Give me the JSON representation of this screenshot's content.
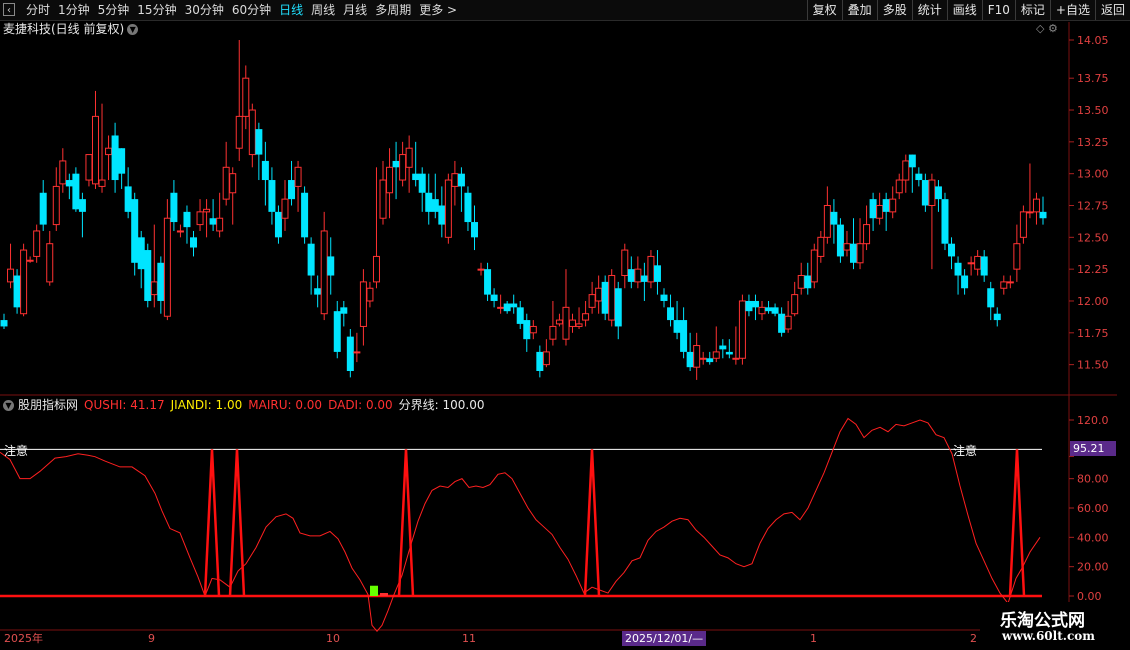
{
  "toolbar": {
    "back_glyph": "‹",
    "periods": [
      "分时",
      "1分钟",
      "5分钟",
      "15分钟",
      "30分钟",
      "60分钟",
      "日线",
      "周线",
      "月线",
      "多周期",
      "更多 >"
    ],
    "selected_period": "日线",
    "right_buttons": [
      "复权",
      "叠加",
      "多股",
      "统计",
      "画线",
      "F10",
      "标记",
      "+自选",
      "返回"
    ]
  },
  "stock": {
    "title": "麦捷科技(日线 前复权)"
  },
  "price_axis": {
    "ticks": [
      "14.05",
      "13.75",
      "13.50",
      "13.25",
      "13.00",
      "12.75",
      "12.50",
      "12.25",
      "12.00",
      "11.75",
      "11.50"
    ]
  },
  "indicator": {
    "name": "股朋指标网",
    "items": [
      {
        "label": "QUSHI: 41.17",
        "color": "#ff3030"
      },
      {
        "label": "JIANDI: 1.00",
        "color": "#ffee00"
      },
      {
        "label": "MAIRU: 0.00",
        "color": "#ff3030"
      },
      {
        "label": "DADI: 0.00",
        "color": "#ff3030"
      },
      {
        "label": "分界线: 100.00",
        "color": "#e8e8e8"
      }
    ],
    "axis_ticks": [
      "120.0",
      "95.21",
      "80.00",
      "60.00",
      "40.00",
      "20.00",
      "0.00"
    ],
    "current_level": "95.21",
    "warning_labels": [
      "注意",
      "注意"
    ]
  },
  "dates": {
    "labels": [
      "2025年",
      "9",
      "10",
      "11",
      "1",
      "2"
    ],
    "highlight": "2025/12/01/—"
  },
  "watermark": {
    "line1": "乐淘公式网",
    "line2": "www.60lt.com"
  },
  "colors": {
    "up": "#ff3232",
    "down": "#00e5ff",
    "qushi": "#ff2020",
    "signal": "#ff1010",
    "jiandi": "#66ff00"
  },
  "chart_data": {
    "type": "candlestick",
    "ylim": [
      11.2,
      14.2
    ],
    "candles": [
      [
        11.85,
        11.8,
        11.9,
        11.78
      ],
      [
        12.15,
        12.25,
        12.45,
        12.1
      ],
      [
        12.2,
        11.95,
        12.25,
        11.9
      ],
      [
        11.9,
        12.4,
        12.45,
        11.88
      ],
      [
        12.32,
        12.32,
        12.35,
        12.3
      ],
      [
        12.35,
        12.55,
        12.6,
        12.3
      ],
      [
        12.85,
        12.6,
        12.95,
        12.55
      ],
      [
        12.15,
        12.45,
        12.55,
        12.12
      ],
      [
        12.6,
        12.9,
        13.05,
        12.55
      ],
      [
        12.92,
        13.1,
        13.2,
        12.85
      ],
      [
        12.95,
        12.9,
        13.0,
        12.8
      ],
      [
        13.0,
        12.72,
        13.05,
        12.7
      ],
      [
        12.8,
        12.7,
        12.85,
        12.5
      ],
      [
        12.95,
        13.15,
        13.15,
        12.9
      ],
      [
        12.92,
        13.45,
        13.65,
        12.88
      ],
      [
        12.9,
        12.95,
        13.55,
        12.85
      ],
      [
        13.15,
        13.2,
        13.3,
        12.95
      ],
      [
        13.3,
        12.95,
        13.4,
        12.85
      ],
      [
        13.2,
        13.0,
        13.2,
        12.88
      ],
      [
        12.9,
        12.7,
        13.05,
        12.65
      ],
      [
        12.8,
        12.3,
        12.85,
        12.2
      ],
      [
        12.5,
        12.25,
        12.55,
        12.1
      ],
      [
        12.4,
        12.0,
        12.45,
        11.95
      ],
      [
        12.05,
        12.15,
        12.6,
        11.95
      ],
      [
        12.3,
        12.0,
        12.35,
        11.9
      ],
      [
        11.88,
        12.65,
        12.8,
        11.85
      ],
      [
        12.85,
        12.62,
        12.95,
        12.55
      ],
      [
        12.55,
        12.55,
        12.6,
        12.5
      ],
      [
        12.7,
        12.58,
        12.75,
        12.45
      ],
      [
        12.5,
        12.42,
        12.55,
        12.35
      ],
      [
        12.6,
        12.7,
        12.8,
        12.55
      ],
      [
        12.7,
        12.72,
        12.8,
        12.5
      ],
      [
        12.65,
        12.6,
        12.8,
        12.55
      ],
      [
        12.55,
        12.65,
        12.85,
        12.5
      ],
      [
        12.8,
        13.05,
        13.25,
        12.75
      ],
      [
        12.85,
        13.0,
        13.05,
        12.6
      ],
      [
        13.2,
        13.45,
        14.05,
        13.1
      ],
      [
        13.45,
        13.75,
        13.85,
        13.35
      ],
      [
        13.15,
        13.5,
        13.55,
        13.05
      ],
      [
        13.35,
        13.15,
        13.4,
        12.95
      ],
      [
        13.1,
        12.95,
        13.25,
        12.75
      ],
      [
        12.95,
        12.7,
        13.05,
        12.6
      ],
      [
        12.7,
        12.5,
        12.75,
        12.45
      ],
      [
        12.65,
        12.8,
        12.95,
        12.55
      ],
      [
        12.95,
        12.8,
        13.1,
        12.75
      ],
      [
        12.9,
        13.05,
        13.1,
        12.7
      ],
      [
        12.85,
        12.5,
        12.9,
        12.45
      ],
      [
        12.45,
        12.2,
        12.5,
        12.05
      ],
      [
        12.1,
        12.05,
        12.2,
        11.95
      ],
      [
        11.9,
        12.55,
        12.7,
        11.85
      ],
      [
        12.35,
        12.2,
        12.5,
        12.05
      ],
      [
        11.92,
        11.6,
        12.0,
        11.55
      ],
      [
        11.95,
        11.9,
        12.0,
        11.8
      ],
      [
        11.72,
        11.45,
        11.78,
        11.4
      ],
      [
        11.6,
        11.6,
        11.75,
        11.52
      ],
      [
        11.8,
        12.15,
        12.25,
        11.65
      ],
      [
        12.0,
        12.1,
        12.15,
        11.95
      ],
      [
        12.15,
        12.35,
        13.05,
        12.1
      ],
      [
        12.65,
        12.95,
        13.1,
        12.6
      ],
      [
        12.85,
        13.05,
        13.2,
        12.65
      ],
      [
        13.1,
        13.05,
        13.25,
        12.8
      ],
      [
        12.95,
        13.15,
        13.25,
        12.9
      ],
      [
        13.05,
        13.2,
        13.3,
        12.85
      ],
      [
        13.0,
        12.95,
        13.25,
        12.9
      ],
      [
        13.0,
        12.85,
        13.05,
        12.7
      ],
      [
        12.85,
        12.7,
        13.0,
        12.6
      ],
      [
        12.8,
        12.7,
        13.0,
        12.65
      ],
      [
        12.75,
        12.6,
        12.9,
        12.5
      ],
      [
        12.5,
        12.95,
        13.0,
        12.45
      ],
      [
        12.9,
        13.0,
        13.1,
        12.75
      ],
      [
        13.0,
        12.9,
        13.05,
        12.7
      ],
      [
        12.85,
        12.62,
        12.9,
        12.55
      ],
      [
        12.62,
        12.5,
        12.75,
        12.4
      ],
      [
        12.25,
        12.25,
        12.3,
        12.2
      ],
      [
        12.25,
        12.05,
        12.3,
        12.0
      ],
      [
        12.05,
        12.0,
        12.1,
        11.95
      ],
      [
        11.95,
        11.95,
        12.05,
        11.9
      ],
      [
        11.98,
        11.92,
        12.0,
        11.9
      ],
      [
        11.98,
        11.95,
        12.05,
        11.9
      ],
      [
        11.95,
        11.82,
        12.0,
        11.78
      ],
      [
        11.85,
        11.7,
        11.9,
        11.6
      ],
      [
        11.75,
        11.8,
        11.85,
        11.7
      ],
      [
        11.6,
        11.45,
        11.65,
        11.4
      ],
      [
        11.5,
        11.6,
        11.7,
        11.48
      ],
      [
        11.7,
        11.8,
        12.0,
        11.65
      ],
      [
        11.82,
        11.85,
        11.9,
        11.8
      ],
      [
        11.7,
        11.95,
        12.25,
        11.65
      ],
      [
        11.8,
        11.85,
        11.9,
        11.75
      ],
      [
        11.8,
        11.82,
        11.95,
        11.78
      ],
      [
        11.85,
        11.9,
        12.0,
        11.8
      ],
      [
        11.95,
        12.05,
        12.15,
        11.9
      ],
      [
        12.0,
        12.1,
        12.2,
        11.9
      ],
      [
        12.15,
        11.9,
        12.2,
        11.85
      ],
      [
        11.85,
        12.2,
        12.25,
        11.8
      ],
      [
        12.1,
        11.8,
        12.15,
        11.7
      ],
      [
        12.2,
        12.4,
        12.45,
        12.1
      ],
      [
        12.25,
        12.15,
        12.35,
        12.1
      ],
      [
        12.15,
        12.25,
        12.35,
        12.1
      ],
      [
        12.2,
        12.15,
        12.3,
        12.0
      ],
      [
        12.15,
        12.35,
        12.4,
        12.1
      ],
      [
        12.28,
        12.15,
        12.4,
        12.05
      ],
      [
        12.05,
        12.0,
        12.1,
        11.95
      ],
      [
        11.95,
        11.85,
        12.05,
        11.8
      ],
      [
        11.85,
        11.75,
        12.0,
        11.7
      ],
      [
        11.85,
        11.6,
        11.95,
        11.55
      ],
      [
        11.6,
        11.48,
        11.75,
        11.45
      ],
      [
        11.48,
        11.65,
        11.75,
        11.38
      ],
      [
        11.55,
        11.55,
        11.6,
        11.5
      ],
      [
        11.55,
        11.52,
        11.6,
        11.5
      ],
      [
        11.55,
        11.6,
        11.8,
        11.52
      ],
      [
        11.65,
        11.62,
        11.7,
        11.55
      ],
      [
        11.6,
        11.58,
        11.7,
        11.55
      ],
      [
        11.55,
        11.55,
        11.8,
        11.5
      ],
      [
        11.55,
        12.0,
        12.05,
        11.5
      ],
      [
        12.0,
        11.92,
        12.05,
        11.88
      ],
      [
        12.0,
        11.95,
        12.05,
        11.85
      ],
      [
        11.9,
        11.95,
        12.0,
        11.85
      ],
      [
        11.95,
        11.92,
        12.0,
        11.9
      ],
      [
        11.95,
        11.9,
        11.98,
        11.88
      ],
      [
        11.9,
        11.75,
        11.95,
        11.72
      ],
      [
        11.78,
        11.88,
        12.0,
        11.75
      ],
      [
        11.9,
        12.05,
        12.15,
        11.88
      ],
      [
        12.1,
        12.2,
        12.3,
        12.05
      ],
      [
        12.2,
        12.1,
        12.3,
        12.05
      ],
      [
        12.15,
        12.4,
        12.45,
        12.1
      ],
      [
        12.35,
        12.5,
        12.55,
        12.3
      ],
      [
        12.5,
        12.75,
        12.9,
        12.45
      ],
      [
        12.7,
        12.6,
        12.8,
        12.45
      ],
      [
        12.6,
        12.35,
        12.65,
        12.3
      ],
      [
        12.4,
        12.45,
        12.55,
        12.35
      ],
      [
        12.45,
        12.3,
        12.65,
        12.25
      ],
      [
        12.3,
        12.45,
        12.65,
        12.25
      ],
      [
        12.45,
        12.6,
        12.75,
        12.4
      ],
      [
        12.8,
        12.65,
        12.85,
        12.55
      ],
      [
        12.65,
        12.75,
        12.85,
        12.6
      ],
      [
        12.8,
        12.7,
        12.85,
        12.55
      ],
      [
        12.7,
        12.8,
        12.9,
        12.65
      ],
      [
        12.85,
        12.95,
        13.0,
        12.8
      ],
      [
        12.95,
        13.1,
        13.15,
        12.85
      ],
      [
        13.15,
        13.05,
        13.15,
        12.85
      ],
      [
        13.0,
        12.95,
        13.05,
        12.9
      ],
      [
        12.95,
        12.75,
        13.0,
        12.7
      ],
      [
        12.75,
        12.95,
        13.0,
        12.25
      ],
      [
        12.9,
        12.8,
        12.95,
        12.7
      ],
      [
        12.8,
        12.45,
        12.85,
        12.4
      ],
      [
        12.45,
        12.35,
        12.5,
        12.25
      ],
      [
        12.3,
        12.2,
        12.35,
        12.05
      ],
      [
        12.2,
        12.1,
        12.25,
        12.05
      ],
      [
        12.3,
        12.3,
        12.35,
        12.2
      ],
      [
        12.25,
        12.35,
        12.4,
        12.2
      ],
      [
        12.35,
        12.2,
        12.4,
        12.15
      ],
      [
        12.1,
        11.95,
        12.15,
        11.85
      ],
      [
        11.9,
        11.85,
        11.95,
        11.8
      ],
      [
        12.1,
        12.15,
        12.2,
        12.05
      ],
      [
        12.15,
        12.15,
        12.2,
        12.1
      ],
      [
        12.25,
        12.45,
        12.6,
        12.15
      ],
      [
        12.5,
        12.7,
        12.75,
        12.45
      ],
      [
        12.7,
        12.7,
        13.08,
        12.65
      ],
      [
        12.7,
        12.8,
        12.85,
        12.6
      ],
      [
        12.7,
        12.65,
        12.82,
        12.6
      ]
    ],
    "qushi": [
      [
        0,
        98
      ],
      [
        10,
        93
      ],
      [
        20,
        80
      ],
      [
        30,
        80
      ],
      [
        40,
        85
      ],
      [
        55,
        94
      ],
      [
        66,
        95
      ],
      [
        78,
        97
      ],
      [
        88,
        96
      ],
      [
        95,
        95
      ],
      [
        105,
        92
      ],
      [
        120,
        88
      ],
      [
        132,
        88
      ],
      [
        145,
        82
      ],
      [
        155,
        70
      ],
      [
        162,
        58
      ],
      [
        170,
        46
      ],
      [
        180,
        43
      ],
      [
        190,
        26
      ],
      [
        198,
        13
      ],
      [
        205,
        0
      ],
      [
        212,
        12
      ],
      [
        220,
        11
      ],
      [
        230,
        6
      ],
      [
        238,
        17
      ],
      [
        246,
        22
      ],
      [
        256,
        33
      ],
      [
        266,
        47
      ],
      [
        276,
        54
      ],
      [
        286,
        56
      ],
      [
        293,
        53
      ],
      [
        300,
        43
      ],
      [
        310,
        41
      ],
      [
        320,
        41
      ],
      [
        330,
        44
      ],
      [
        338,
        39
      ],
      [
        345,
        30
      ],
      [
        352,
        19
      ],
      [
        360,
        11
      ],
      [
        368,
        1
      ],
      [
        372,
        -20
      ],
      [
        377,
        -24
      ],
      [
        382,
        -20
      ],
      [
        388,
        -10
      ],
      [
        394,
        1
      ],
      [
        402,
        14
      ],
      [
        410,
        33
      ],
      [
        418,
        51
      ],
      [
        425,
        63
      ],
      [
        432,
        72
      ],
      [
        440,
        75
      ],
      [
        448,
        74
      ],
      [
        455,
        78
      ],
      [
        462,
        80
      ],
      [
        469,
        74
      ],
      [
        476,
        75
      ],
      [
        483,
        74
      ],
      [
        490,
        76
      ],
      [
        498,
        83
      ],
      [
        505,
        84
      ],
      [
        512,
        80
      ],
      [
        520,
        70
      ],
      [
        528,
        60
      ],
      [
        536,
        52
      ],
      [
        544,
        47
      ],
      [
        552,
        42
      ],
      [
        560,
        33
      ],
      [
        568,
        25
      ],
      [
        576,
        14
      ],
      [
        584,
        2
      ],
      [
        592,
        6
      ],
      [
        600,
        4
      ],
      [
        608,
        2
      ],
      [
        616,
        10
      ],
      [
        624,
        16
      ],
      [
        632,
        24
      ],
      [
        640,
        26
      ],
      [
        648,
        38
      ],
      [
        656,
        44
      ],
      [
        664,
        47
      ],
      [
        672,
        51
      ],
      [
        680,
        53
      ],
      [
        688,
        52
      ],
      [
        696,
        45
      ],
      [
        704,
        40
      ],
      [
        712,
        34
      ],
      [
        720,
        28
      ],
      [
        728,
        26
      ],
      [
        736,
        22
      ],
      [
        744,
        20
      ],
      [
        752,
        22
      ],
      [
        760,
        36
      ],
      [
        768,
        46
      ],
      [
        776,
        52
      ],
      [
        784,
        56
      ],
      [
        792,
        57
      ],
      [
        800,
        52
      ],
      [
        808,
        60
      ],
      [
        816,
        72
      ],
      [
        824,
        84
      ],
      [
        832,
        98
      ],
      [
        840,
        112
      ],
      [
        848,
        121
      ],
      [
        856,
        117
      ],
      [
        864,
        108
      ],
      [
        872,
        113
      ],
      [
        880,
        115
      ],
      [
        888,
        112
      ],
      [
        896,
        117
      ],
      [
        904,
        116
      ],
      [
        912,
        118
      ],
      [
        920,
        120
      ],
      [
        928,
        118
      ],
      [
        936,
        110
      ],
      [
        944,
        108
      ],
      [
        952,
        97
      ],
      [
        960,
        75
      ],
      [
        968,
        55
      ],
      [
        976,
        36
      ],
      [
        984,
        24
      ],
      [
        992,
        12
      ],
      [
        1000,
        2
      ],
      [
        1008,
        -5
      ],
      [
        1016,
        12
      ],
      [
        1022,
        19
      ],
      [
        1030,
        30
      ],
      [
        1040,
        40
      ]
    ],
    "signals": [
      212,
      237,
      406,
      592,
      1017
    ],
    "jiandi_bar": {
      "x": 374,
      "value": 7
    }
  }
}
